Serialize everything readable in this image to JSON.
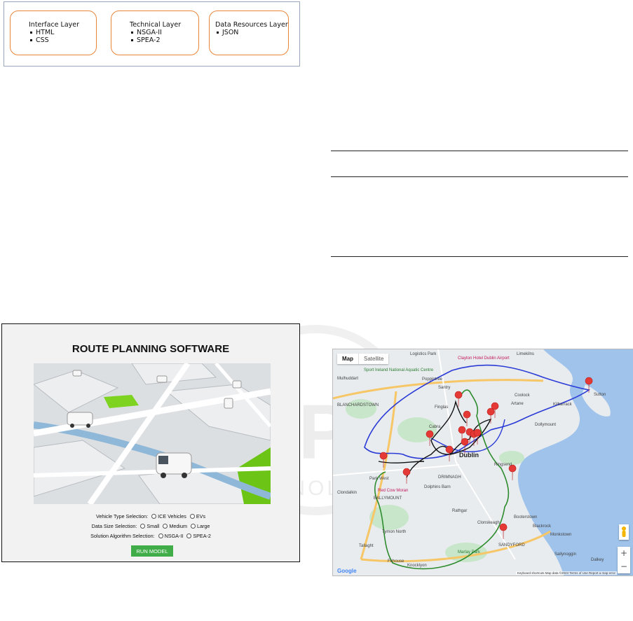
{
  "architecture": {
    "layers": [
      {
        "title": "Interface Layer",
        "items": [
          "HTML",
          "CSS"
        ]
      },
      {
        "title": "Technical Layer",
        "items": [
          "NSGA-II",
          "SPEA-2"
        ]
      },
      {
        "title": "Data Resources Layer",
        "items": [
          "JSON"
        ]
      }
    ]
  },
  "watermark": {
    "main": "SCITEPRESS",
    "sub": "SCIENCE AND TECHNOLOGY PUBLICATIONS"
  },
  "software": {
    "title": "ROUTE PLANNING SOFTWARE",
    "vehicle": {
      "label": "Vehicle Type Selection:",
      "options": [
        "ICE Vehicles",
        "EVs"
      ]
    },
    "size": {
      "label": "Data Size Selection:",
      "options": [
        "Small",
        "Medium",
        "Large"
      ]
    },
    "algorithm": {
      "label": "Solution Algorithm Selection:",
      "options": [
        "NSGA-II",
        "SPEA-2"
      ]
    },
    "run_label": "RUN MODEL"
  },
  "map": {
    "tabs": [
      "Map",
      "Satellite"
    ],
    "labels": {
      "logistics": "Logistics Park",
      "limekilns": "Limekilns",
      "mulhuddart": "Mulhuddart",
      "sport": "Sport Ireland National Aquatic Centre",
      "clayton": "Clayton Hotel Dublin Airport",
      "santry": "Santry",
      "coolock": "Coolock",
      "artane": "Artane",
      "blanch": "BLANCHARDSTOWN",
      "kilbarrack": "Kilbarrack",
      "sutton": "Sutton",
      "cabra": "Cabra",
      "dollymount": "Dollymount",
      "dublin": "Dublin",
      "ringsend": "Ringsend",
      "parkwest": "Park West",
      "drimnagh": "DRIMNAGH",
      "clondalkin": "Clondalkin",
      "rathgar": "Rathgar",
      "clonskeagh": "Clonskeagh",
      "blackrock": "Blackrock",
      "monkstown": "Monkstown",
      "tymon": "Tymon North",
      "tallaght": "Tallaght",
      "sandyford": "SANDYFORD",
      "sallynoggin": "Sallynoggin",
      "dalkey": "Dalkey",
      "firhouse": "Firhouse",
      "knocklyon": "Knocklyon",
      "ballymount": "BALLYMOUNT",
      "redcow": "Red Cow Moran",
      "marlay": "Marlay Park",
      "booterstown": "Booterstown",
      "dolphins": "Dolphins Barn",
      "finglas": "Finglas",
      "poppintree": "Poppintree"
    },
    "footer": "Keyboard shortcuts  Map data ©2023  Terms of Use  Report a map error",
    "google": "Google"
  }
}
